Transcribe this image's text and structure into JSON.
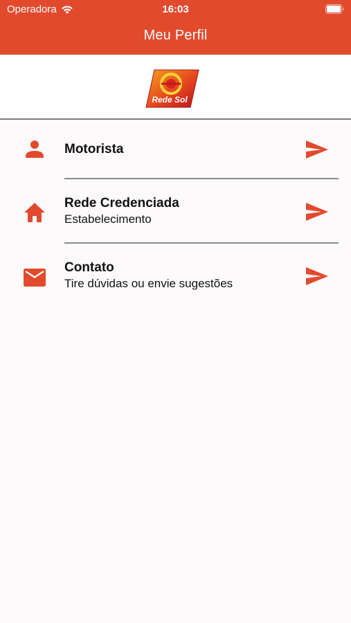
{
  "status_bar": {
    "carrier": "Operadora",
    "time": "16:03"
  },
  "header": {
    "title": "Meu Perfil"
  },
  "logo": {
    "text": "Rede Sol"
  },
  "menu": {
    "items": [
      {
        "icon": "person-icon",
        "title": "Motorista",
        "subtitle": ""
      },
      {
        "icon": "home-icon",
        "title": "Rede Credenciada",
        "subtitle": "Estabelecimento"
      },
      {
        "icon": "mail-icon",
        "title": "Contato",
        "subtitle": "Tire dúvidas ou envie sugestões"
      }
    ]
  },
  "colors": {
    "accent": "#e24a2e",
    "background": "#fcfafa",
    "divider": "#8a8a8a"
  }
}
